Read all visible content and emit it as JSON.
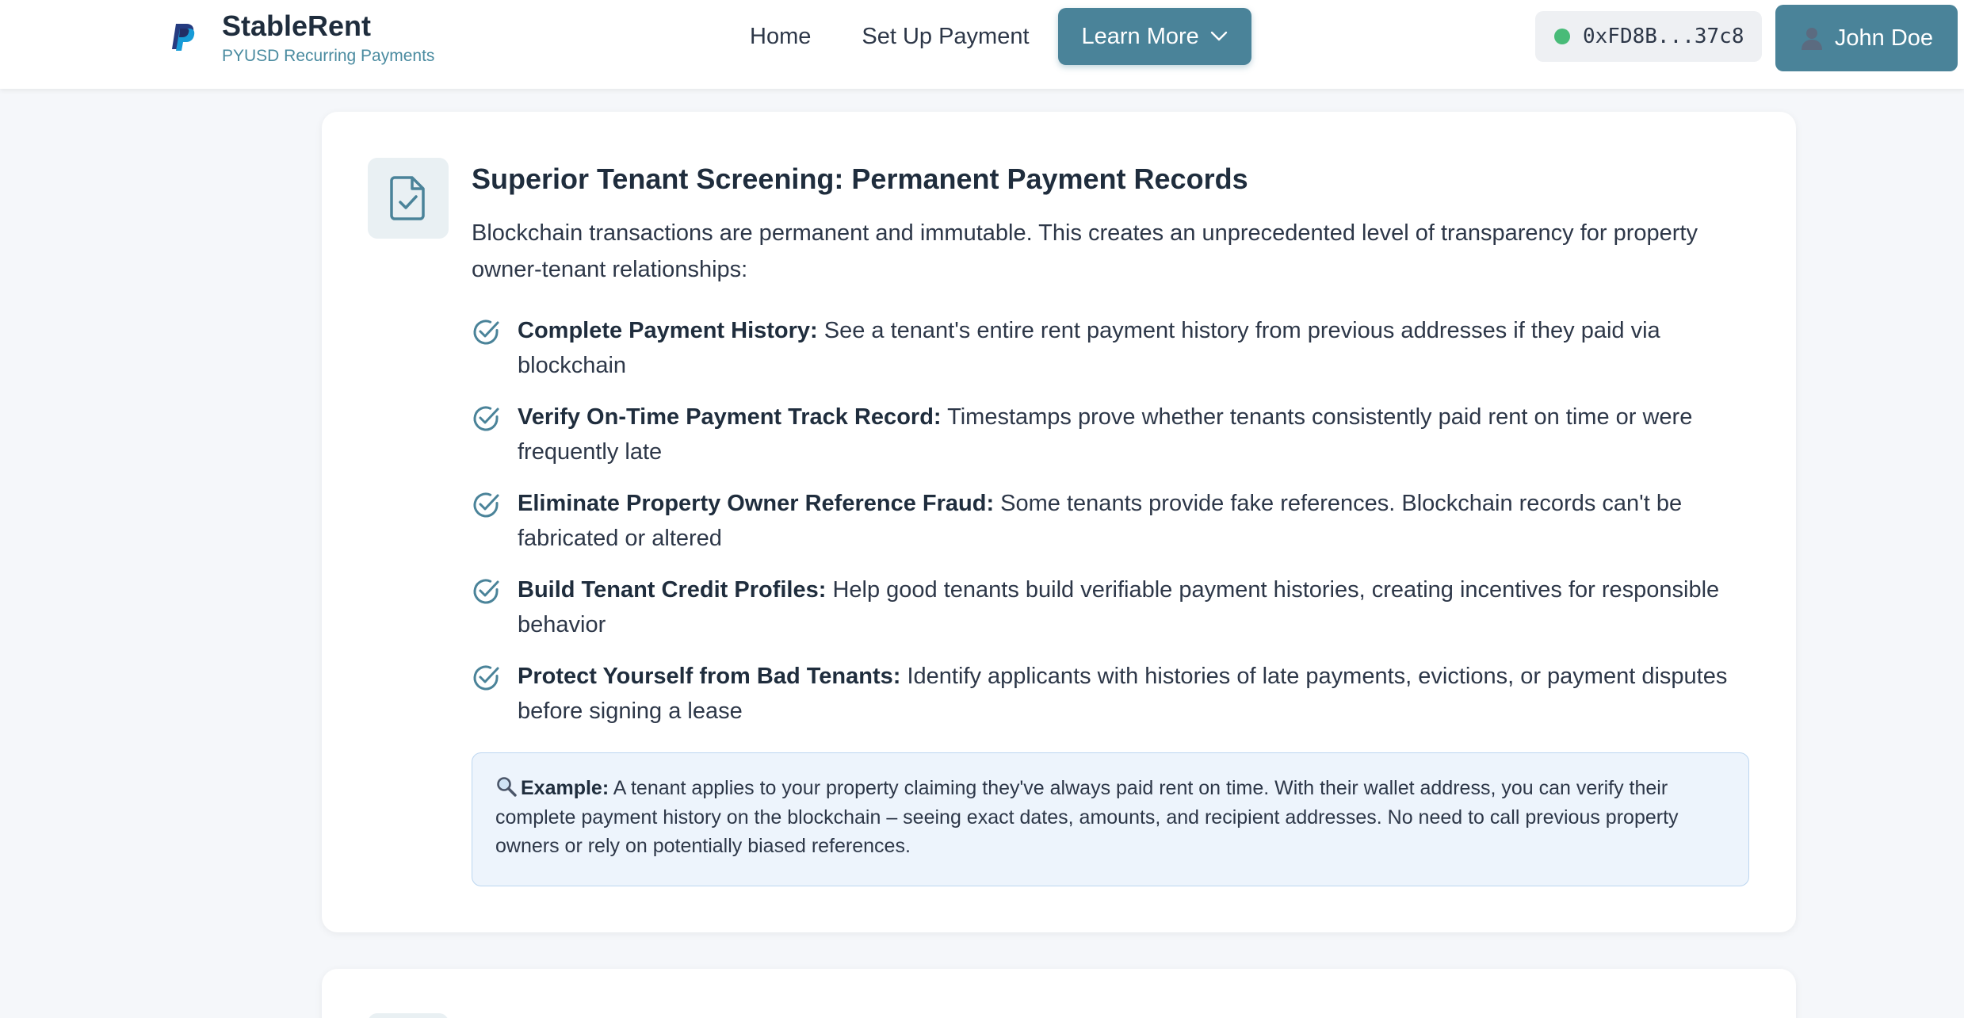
{
  "brand": {
    "name": "StableRent",
    "subtitle": "PYUSD Recurring Payments",
    "logo_icon": "paypal-logo-icon"
  },
  "nav": {
    "home": "Home",
    "setup": "Set Up Payment",
    "learn_more": "Learn More"
  },
  "wallet": {
    "address": "0xFD8B...37c8",
    "status_color": "#48bb78"
  },
  "user": {
    "name": "John Doe",
    "icon": "person-icon"
  },
  "card": {
    "icon": "document-check-icon",
    "title": "Superior Tenant Screening: Permanent Payment Records",
    "intro": "Blockchain transactions are permanent and immutable. This creates an unprecedented level of transparency for property owner-tenant relationships:",
    "features": [
      {
        "title": "Complete Payment History:",
        "text": " See a tenant's entire rent payment history from previous addresses if they paid via blockchain"
      },
      {
        "title": "Verify On-Time Payment Track Record:",
        "text": " Timestamps prove whether tenants consistently paid rent on time or were frequently late"
      },
      {
        "title": "Eliminate Property Owner Reference Fraud:",
        "text": " Some tenants provide fake references. Blockchain records can't be fabricated or altered"
      },
      {
        "title": "Build Tenant Credit Profiles:",
        "text": " Help good tenants build verifiable payment histories, creating incentives for responsible behavior"
      },
      {
        "title": "Protect Yourself from Bad Tenants:",
        "text": " Identify applicants with histories of late payments, evictions, or payment disputes before signing a lease"
      }
    ],
    "example": {
      "icon": "magnifier-icon",
      "label": "Example:",
      "text": " A tenant applies to your property claiming they've always paid rent on time. With their wallet address, you can verify their complete payment history on the blockchain – seeing exact dates, amounts, and recipient addresses. No need to call previous property owners or rely on potentially biased references."
    }
  },
  "colors": {
    "accent": "#4a8399",
    "background": "#f5f7fa",
    "example_bg": "#edf4fc",
    "example_border": "#bcd6f0"
  }
}
